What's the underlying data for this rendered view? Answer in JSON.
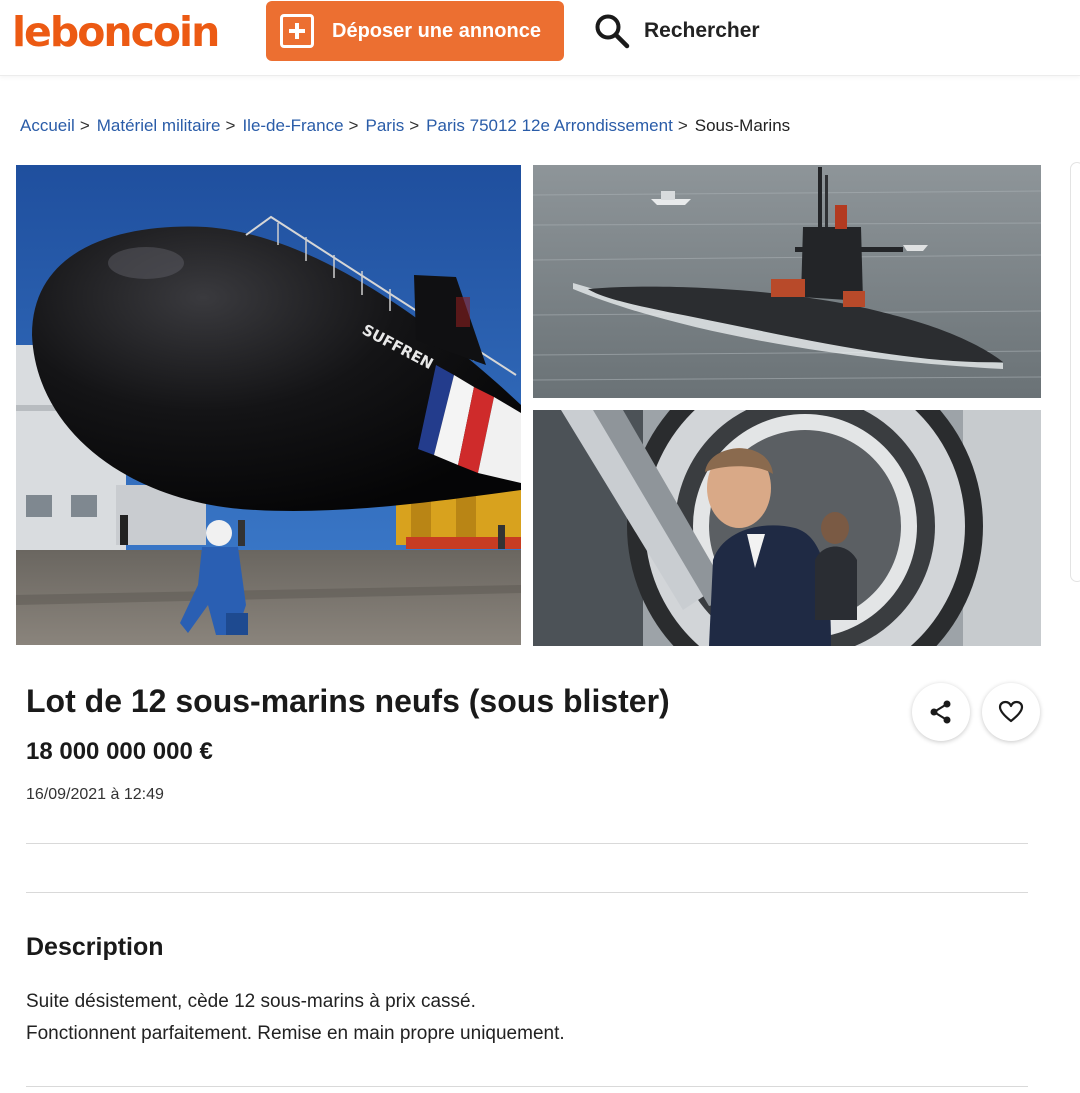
{
  "header": {
    "logo": "leboncoin",
    "post_ad_label": "Déposer une annonce",
    "search_label": "Rechercher"
  },
  "breadcrumb": {
    "items": [
      "Accueil",
      "Matériel militaire",
      "Ile-de-France",
      "Paris",
      "Paris 75012 12e Arrondissement"
    ],
    "separator": ">",
    "current": "Sous-Marins"
  },
  "photos": {
    "hull_lettering": "SUFFREN"
  },
  "ad": {
    "title": "Lot de 12 sous-marins neufs (sous blister)",
    "price": "18 000 000 000 €",
    "date": "16/09/2021 à 12:49"
  },
  "description": {
    "heading": "Description",
    "lines": [
      "Suite désistement, cède 12 sous-marins à prix cassé.",
      "Fonctionnent parfaitement. Remise en main propre uniquement."
    ]
  },
  "colors": {
    "brand": "#ec5a13",
    "button": "#ec6f31",
    "link": "#2a5ca8"
  },
  "icons": [
    "plus-square-icon",
    "search-icon",
    "share-icon",
    "heart-icon"
  ]
}
